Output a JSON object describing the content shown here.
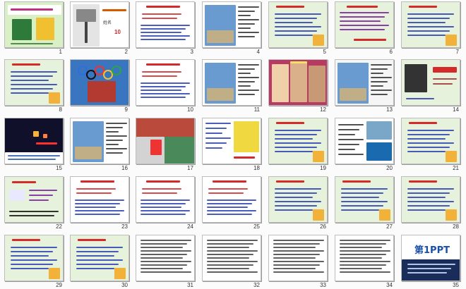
{
  "app": {
    "view": "slide-sorter"
  },
  "colors": {
    "background": "#fbfbfb",
    "slide_border": "#bdbdbd",
    "green_wash": "#e8f3dd",
    "red_text": "#d42a2a",
    "blue_text": "#2a3fb0",
    "purple_text": "#7a1f9c"
  },
  "slides": [
    {
      "number": "1",
      "kind": "title-art",
      "bg": "#d9efc6"
    },
    {
      "number": "2",
      "kind": "tree",
      "bg": "#ffffff",
      "caption_a": "姓名",
      "caption_b": "10"
    },
    {
      "number": "3",
      "kind": "text-red",
      "bg": "#ffffff"
    },
    {
      "number": "4",
      "kind": "photo-text",
      "bg": "#ffffff"
    },
    {
      "number": "5",
      "kind": "green-text",
      "bg": "#e6f2dc"
    },
    {
      "number": "6",
      "kind": "green-text-red",
      "bg": "#e6f2dc"
    },
    {
      "number": "7",
      "kind": "green-text",
      "bg": "#e6f2dc"
    },
    {
      "number": "8",
      "kind": "green-text",
      "bg": "#e6f2dc"
    },
    {
      "number": "9",
      "kind": "olympic",
      "bg": "#2c6ab3"
    },
    {
      "number": "10",
      "kind": "text-red",
      "bg": "#ffffff"
    },
    {
      "number": "11",
      "kind": "photo-text",
      "bg": "#ffffff"
    },
    {
      "number": "12",
      "kind": "stage-photo",
      "bg": "#b83a62"
    },
    {
      "number": "13",
      "kind": "photo-text",
      "bg": "#f5f5f5"
    },
    {
      "number": "14",
      "kind": "portrait-text",
      "bg": "#e6f2dc"
    },
    {
      "number": "15",
      "kind": "space",
      "bg": "#0b0b1a"
    },
    {
      "number": "16",
      "kind": "photo-text",
      "bg": "#ffffff"
    },
    {
      "number": "17",
      "kind": "sports",
      "bg": "#c7463a"
    },
    {
      "number": "18",
      "kind": "text-yellow",
      "bg": "#ffffff"
    },
    {
      "number": "19",
      "kind": "green-text",
      "bg": "#e6f2dc"
    },
    {
      "number": "20",
      "kind": "ice",
      "bg": "#ffffff"
    },
    {
      "number": "21",
      "kind": "green-text",
      "bg": "#e6f2dc"
    },
    {
      "number": "22",
      "kind": "mind-map",
      "bg": "#e6f2dc"
    },
    {
      "number": "23",
      "kind": "text-red",
      "bg": "#ffffff"
    },
    {
      "number": "24",
      "kind": "text-red",
      "bg": "#ffffff"
    },
    {
      "number": "25",
      "kind": "text-red",
      "bg": "#ffffff"
    },
    {
      "number": "26",
      "kind": "green-text",
      "bg": "#e6f2dc"
    },
    {
      "number": "27",
      "kind": "green-text",
      "bg": "#e6f2dc"
    },
    {
      "number": "28",
      "kind": "green-text",
      "bg": "#e6f2dc"
    },
    {
      "number": "29",
      "kind": "green-text",
      "bg": "#e6f2dc"
    },
    {
      "number": "30",
      "kind": "green-text",
      "bg": "#e6f2dc"
    },
    {
      "number": "31",
      "kind": "text-dark",
      "bg": "#ffffff"
    },
    {
      "number": "32",
      "kind": "text-dark",
      "bg": "#ffffff"
    },
    {
      "number": "33",
      "kind": "text-dark",
      "bg": "#ffffff"
    },
    {
      "number": "34",
      "kind": "text-dark",
      "bg": "#ffffff"
    },
    {
      "number": "35",
      "kind": "ppt-logo",
      "bg": "#ffffff",
      "logo_big": "第1PPT"
    }
  ]
}
